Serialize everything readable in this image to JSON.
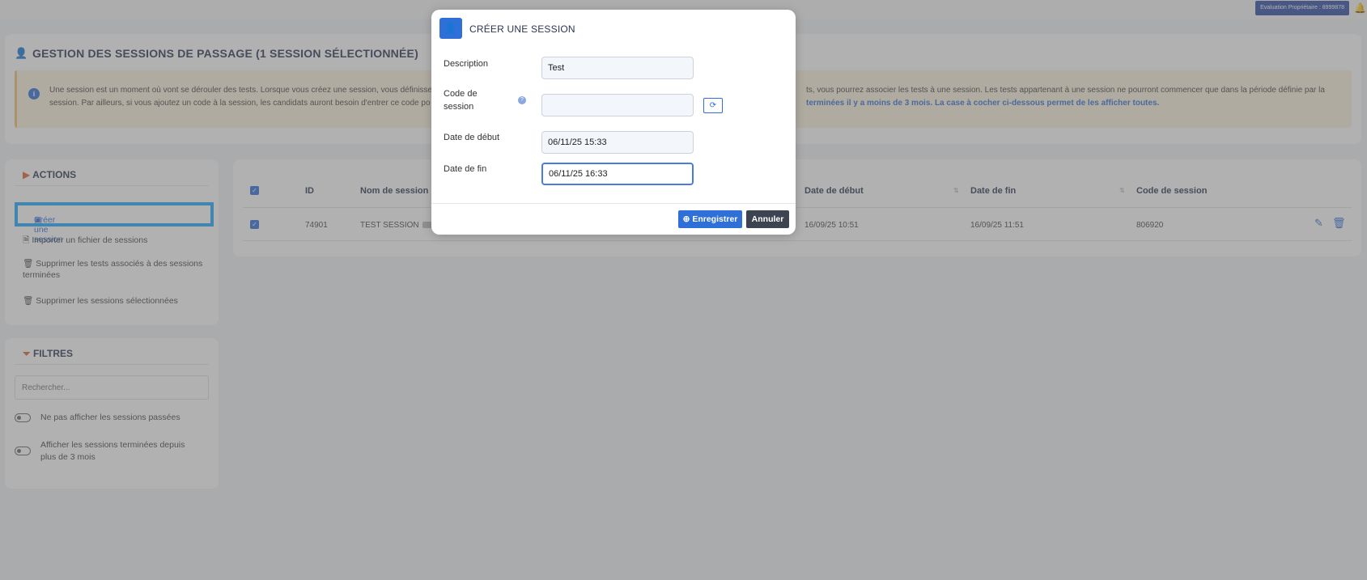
{
  "topbar": {
    "badge": "Evaluation Propriétaire : 8999878"
  },
  "header": {
    "title": "GESTION DES SESSIONS DE PASSAGE (1 SESSION SÉLECTIONNÉE)",
    "info_line1": "Une session est un moment où vont se dérouler des tests. Lorsque vous créez une session, vous définisse",
    "info_line2": "session. Par ailleurs, si vous ajoutez un code à la session, les candidats auront besoin d'entrer ce code po",
    "info_line1_right": "ts, vous pourrez associer les tests à une session. Les tests appartenant à une session ne pourront commencer que dans la période définie par la",
    "info_link": "terminées il y a moins de 3 mois. La case à cocher ci-dessous permet de les afficher toutes."
  },
  "actions": {
    "title": "ACTIONS",
    "create": "Créer une session",
    "import": "Importer un fichier de sessions",
    "delete_tests": "Supprimer les tests associés à des sessions",
    "delete_tests_2": "terminées",
    "delete_selected": "Supprimer les sessions sélectionnées"
  },
  "filters": {
    "title": "FILTRES",
    "search_placeholder": "Rechercher...",
    "toggle1": "Ne pas afficher les sessions passées",
    "toggle2_line1": "Afficher les sessions terminées depuis",
    "toggle2_line2": "plus de 3 mois"
  },
  "table": {
    "columns": [
      "ID",
      "Nom de session",
      "Date de début",
      "Date de fin",
      "Code de session"
    ],
    "rows": [
      {
        "id": "74901",
        "name": "TEST SESSION",
        "start": "16/09/25 10:51",
        "end": "16/09/25 11:51",
        "code": "806920"
      }
    ]
  },
  "modal": {
    "title": "CRÉER UNE SESSION",
    "description_label": "Description",
    "description_value": "Test",
    "code_label_1": "Code de",
    "code_label_2": "session",
    "code_value": "",
    "start_label": "Date de début",
    "start_value": "06/11/25 15:33",
    "end_label": "Date de fin",
    "end_value": "06/11/25 16:33",
    "save": "Enregistrer",
    "cancel": "Annuler"
  }
}
